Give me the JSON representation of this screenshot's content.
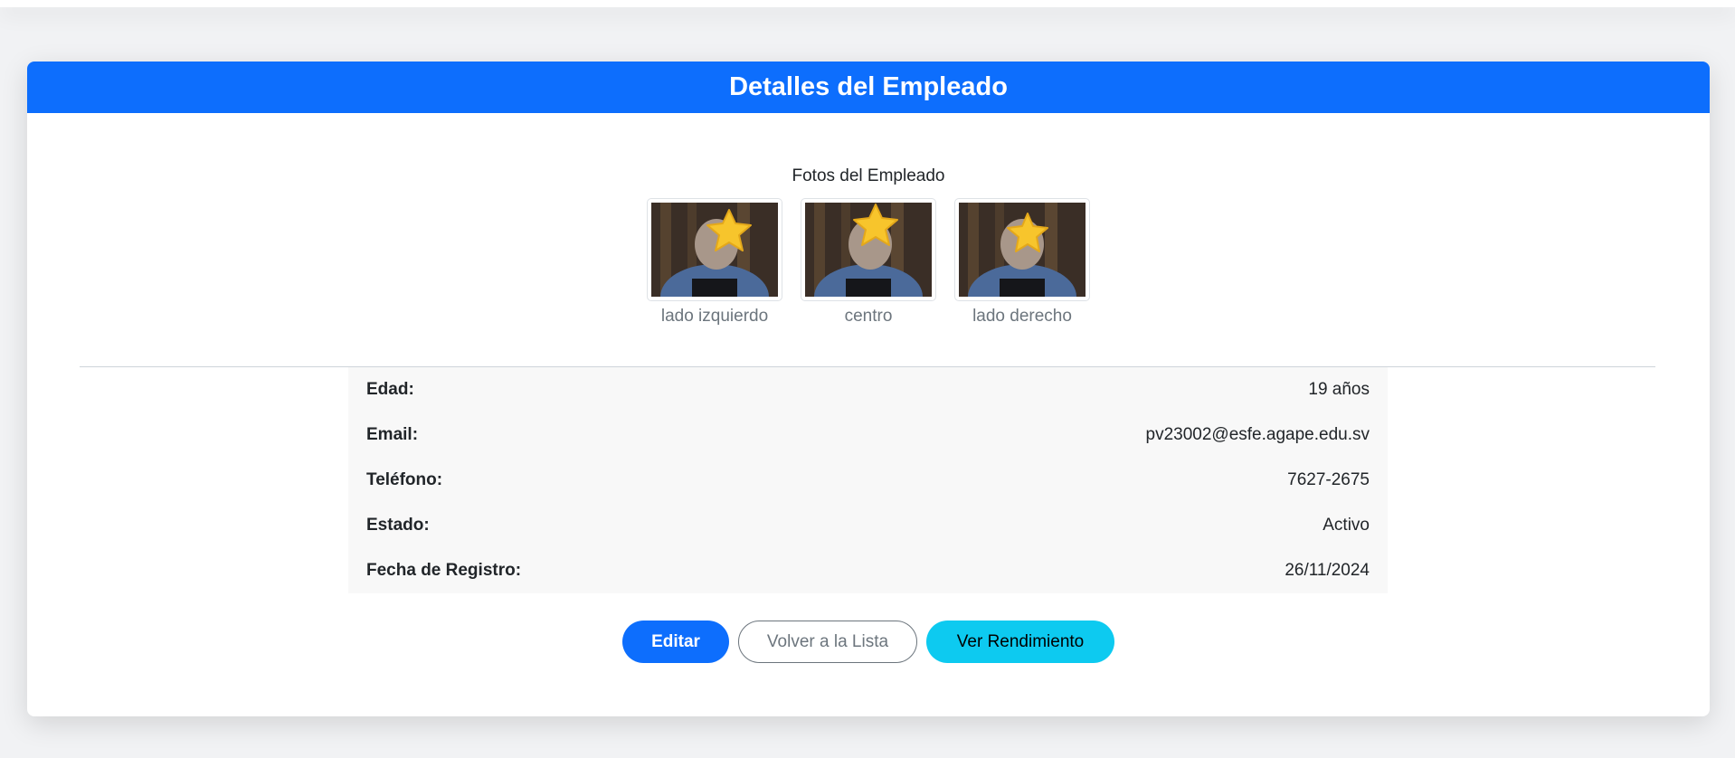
{
  "header": {
    "title": "Detalles del Empleado"
  },
  "photos": {
    "title": "Fotos del Empleado",
    "items": [
      {
        "label": "lado izquierdo"
      },
      {
        "label": "centro"
      },
      {
        "label": "lado derecho"
      }
    ]
  },
  "details": {
    "rows": [
      {
        "label": "Edad:",
        "value": "19 años"
      },
      {
        "label": "Email:",
        "value": "pv23002@esfe.agape.edu.sv"
      },
      {
        "label": "Teléfono:",
        "value": "7627-2675"
      },
      {
        "label": "Estado:",
        "value": "Activo"
      },
      {
        "label": "Fecha de Registro:",
        "value": "26/11/2024"
      }
    ]
  },
  "actions": {
    "edit": "Editar",
    "back": "Volver a la Lista",
    "performance": "Ver Rendimiento"
  },
  "colors": {
    "primary": "#0d6efd",
    "info": "#0dcaf0",
    "secondary": "#6c757d"
  }
}
